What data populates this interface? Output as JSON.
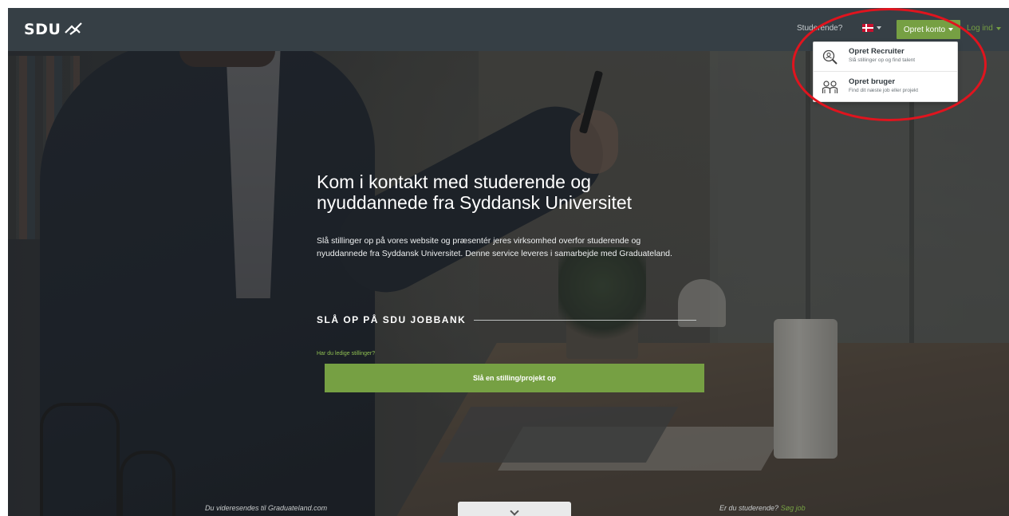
{
  "navbar": {
    "logo_text": "SDU",
    "student_link": "Studerende?",
    "language": "da",
    "create_account_label": "Opret konto",
    "login_label": "Log ind"
  },
  "dropdown": {
    "items": [
      {
        "title": "Opret Recruiter",
        "subtitle": "Slå stillinger op og find talent",
        "icon": "recruiter-search-icon"
      },
      {
        "title": "Opret bruger",
        "subtitle": "Find dit næste job eller projekt",
        "icon": "users-icon"
      }
    ]
  },
  "hero": {
    "title": "Kom i kontakt med studerende og nyuddannede fra Syddansk Universitet",
    "text": "Slå stillinger op på vores website og præsentér jeres virksomhed overfor studerende og nyuddannede fra Syddansk Universitet. Denne service leveres i samarbejde med Graduateland.",
    "section_heading": "SLÅ OP PÅ SDU JOBBANK",
    "cta_question": "Har du ledige stillinger?",
    "cta_button": "Slå en stilling/projekt op"
  },
  "footer": {
    "left_text": "Du videresendes til Graduateland.com",
    "right_text": "Er du studerende?",
    "right_link": "Søg job"
  },
  "colors": {
    "brand_green": "#76a043",
    "navbar": "#363f45",
    "annotation_red": "#e0141e"
  }
}
